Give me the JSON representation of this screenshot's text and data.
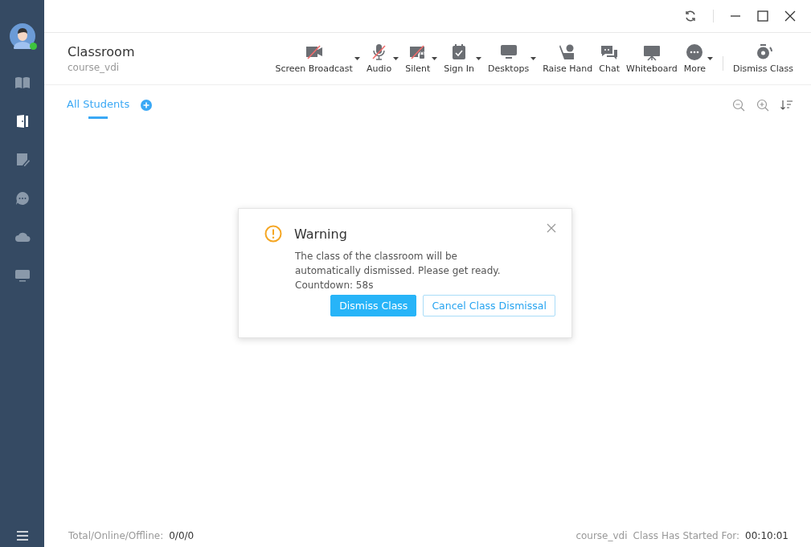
{
  "sidebar": {
    "status_online": true,
    "items": [
      {
        "kind": "book",
        "selected": false
      },
      {
        "kind": "door",
        "selected": true
      },
      {
        "kind": "note",
        "selected": false
      },
      {
        "kind": "chat",
        "selected": false
      },
      {
        "kind": "cloud",
        "selected": false
      },
      {
        "kind": "monitor",
        "selected": false
      }
    ]
  },
  "header": {
    "title": "Classroom",
    "subtitle": "course_vdi"
  },
  "toolbar": [
    {
      "kind": "broadcast",
      "label": "Screen Broadcast",
      "muted": true,
      "dropdown": true
    },
    {
      "kind": "audio",
      "label": "Audio",
      "muted": true,
      "dropdown": true
    },
    {
      "kind": "silent",
      "label": "Silent",
      "muted": true,
      "dropdown": true
    },
    {
      "kind": "signin",
      "label": "Sign In",
      "muted": false,
      "dropdown": true
    },
    {
      "kind": "desktops",
      "label": "Desktops",
      "muted": false,
      "dropdown": true
    },
    {
      "kind": "raisehand",
      "label": "Raise Hand",
      "muted": false,
      "dropdown": false
    },
    {
      "kind": "chat",
      "label": "Chat",
      "muted": false,
      "dropdown": false
    },
    {
      "kind": "whiteboard",
      "label": "Whiteboard",
      "muted": false,
      "dropdown": false
    },
    {
      "kind": "more",
      "label": "More",
      "muted": false,
      "dropdown": true
    }
  ],
  "dismiss_button": {
    "label": "Dismiss Class"
  },
  "tabs": [
    {
      "label": "All Students",
      "selected": true
    }
  ],
  "dialog": {
    "title": "Warning",
    "message": "The class of the classroom will be automatically dismissed. Please get ready.",
    "countdown": "Countdown: 58s",
    "buttons": [
      {
        "label": "Dismiss Class",
        "kind": "primary"
      },
      {
        "label": "Cancel Class Dismissal",
        "kind": "secondary"
      }
    ]
  },
  "status_bar": {
    "counts_label": "Total/Online/Offline:",
    "counts": "0/0/0",
    "course": "course_vdi",
    "started_label": "Class Has Started For:",
    "elapsed": "00:10:01"
  }
}
